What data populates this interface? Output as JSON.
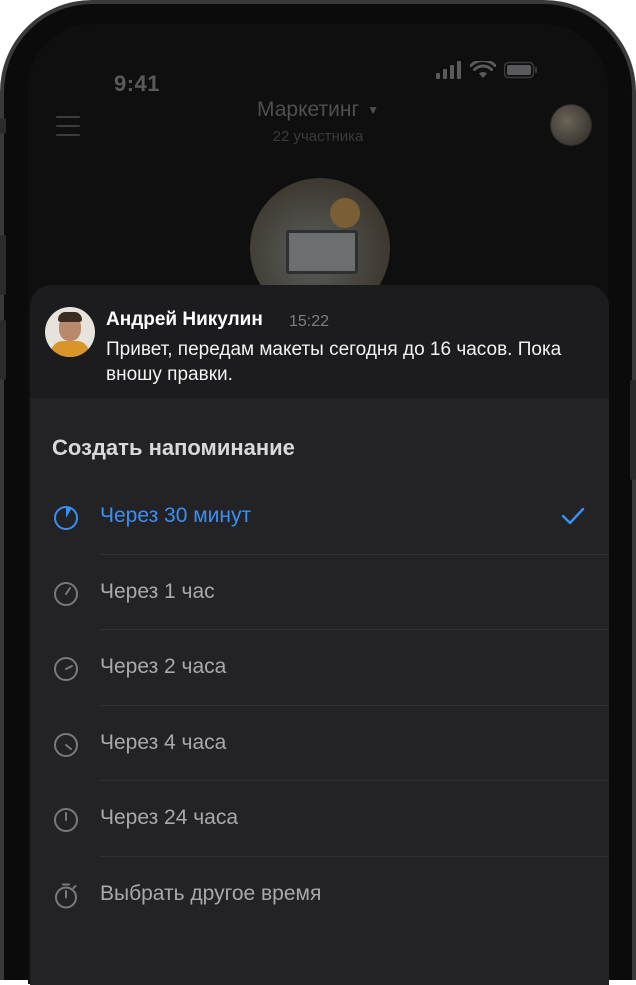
{
  "status_bar": {
    "time": "9:41"
  },
  "chat_header": {
    "title": "Маркетинг",
    "subtitle": "22 участника"
  },
  "message": {
    "author": "Андрей Никулин",
    "time": "15:22",
    "text": "Привет, передам макеты сегодня до 16 часов. Пока вношу правки."
  },
  "reminder_sheet": {
    "title": "Создать напоминание",
    "options": [
      {
        "label": "Через 30 минут",
        "icon": "clock-icon",
        "selected": true
      },
      {
        "label": "Через 1 час",
        "icon": "clock-icon",
        "selected": false
      },
      {
        "label": "Через 2 часа",
        "icon": "clock-icon",
        "selected": false
      },
      {
        "label": "Через 4 часа",
        "icon": "clock-icon",
        "selected": false
      },
      {
        "label": "Через 24 часа",
        "icon": "clock-icon",
        "selected": false
      },
      {
        "label": "Выбрать другое время",
        "icon": "stopwatch-icon",
        "selected": false
      }
    ]
  },
  "colors": {
    "accent": "#3a8ff5",
    "sheet_bg": "#232325",
    "message_bg": "#1c1c1e"
  }
}
